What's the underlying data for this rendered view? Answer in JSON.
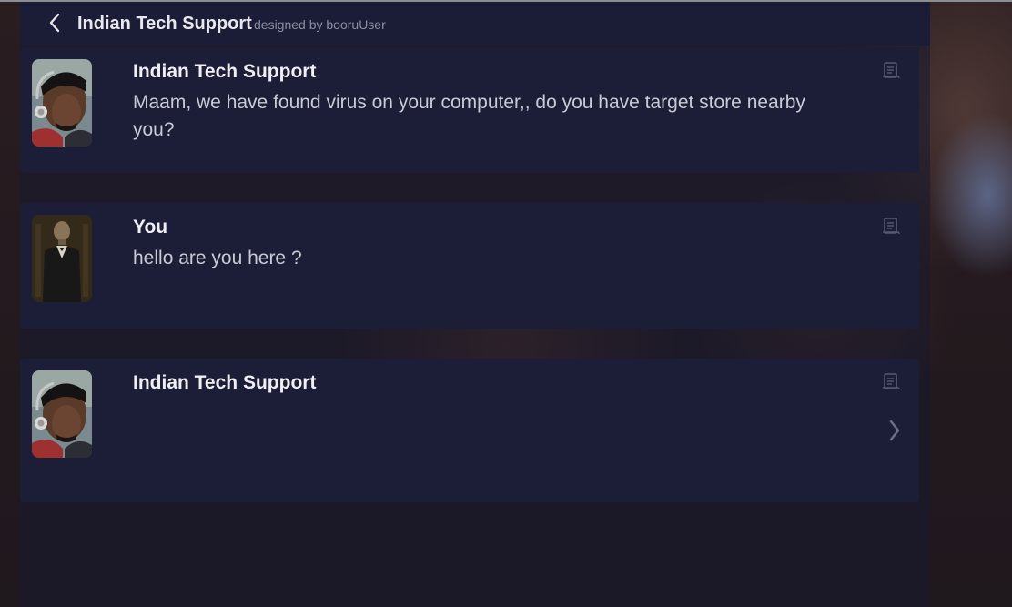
{
  "header": {
    "title": "Indian Tech Support",
    "credit": "designed by booruUser",
    "back_icon": "chevron-left-icon"
  },
  "messages": [
    {
      "name": "Indian Tech Support",
      "text": "Maam, we have found virus on your computer,, do you have target store nearby you?",
      "avatar": "tech-support-avatar",
      "icon": "history-scroll-icon"
    },
    {
      "name": "You",
      "text": "hello are you here ?",
      "avatar": "user-avatar",
      "icon": "history-scroll-icon"
    },
    {
      "name": "Indian Tech Support",
      "text": "",
      "avatar": "tech-support-avatar",
      "icon": "history-scroll-icon",
      "next_icon": "chevron-right-icon"
    }
  ],
  "colors": {
    "card_background": "#1c1d37",
    "header_background": "#1b1c35",
    "name_text": "#f0f0f4",
    "message_text": "#c9cad6",
    "credit_text": "#8e8fa3"
  }
}
